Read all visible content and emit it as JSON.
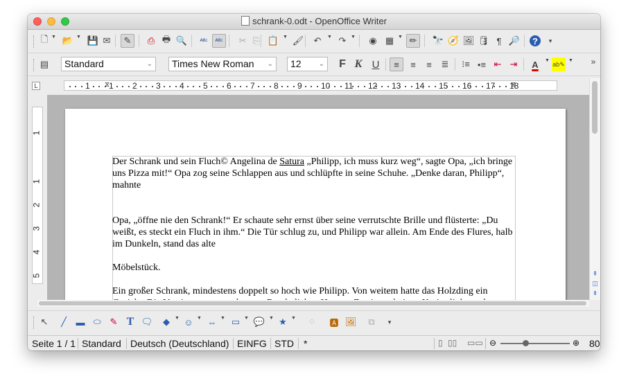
{
  "window": {
    "title": "schrank-0.odt - OpenOffice Writer"
  },
  "toolbar_standard": {
    "icons": [
      "new-icon",
      "open-icon",
      "save-icon",
      "email-icon",
      "edit-mode-icon",
      "export-pdf-icon",
      "print-icon",
      "page-preview-icon",
      "spellcheck-icon",
      "autospellcheck-icon",
      "cut-icon",
      "copy-icon",
      "paste-icon",
      "format-paintbrush-icon",
      "undo-icon",
      "redo-icon",
      "navigator-icon",
      "table-icon",
      "show-draw-functions-icon",
      "find-replace-icon",
      "compass-icon",
      "gallery-icon",
      "data-sources-icon",
      "formatting-marks-icon",
      "zoom-icon",
      "help-icon"
    ],
    "glyphs": [
      "🗋",
      "📂",
      "💾",
      "✉",
      "✎",
      "⎙",
      "🖶",
      "🔍",
      "ᴬᴮᶜ",
      "ᴬᴮᶜ",
      "✂",
      "⎘",
      "📋",
      "🖌",
      "↶",
      "↷",
      "◉",
      "▦",
      "✏",
      "🔭",
      "🧭",
      "🖼",
      "🛢",
      "¶",
      "🔎",
      "?"
    ]
  },
  "toolbar_formatting": {
    "style": "Standard",
    "font": "Times New Roman",
    "size": "12",
    "bold": "F",
    "italic": "K",
    "underline": "U"
  },
  "ruler": {
    "horizontal": [
      "1",
      "1",
      "2",
      "3",
      "4",
      "5",
      "6",
      "7",
      "8",
      "9",
      "10",
      "11",
      "12",
      "13",
      "14",
      "15",
      "16",
      "17",
      "18"
    ],
    "vertical": [
      "1",
      "1",
      "2",
      "3",
      "4",
      "5"
    ]
  },
  "document": {
    "p1": "Der Schrank und sein Fluch© Angelina de ",
    "p1_underlined": "Satura",
    "p1_rest": " „Philipp, ich muss kurz weg“, sagte Opa, „ich bringe uns Pizza mit!“ Opa zog seine Schlappen aus und schlüpfte in seine Schuhe. „Denke daran, Philipp“, mahnte",
    "p2": "Opa, „öffne nie den Schrank!“ Er schaute sehr ernst über seine verrutschte Brille und flüsterte: „Du weißt, es steckt ein Fluch in ihm.“ Die Tür schlug zu, und Philipp war allein. Am Ende des Flures, halb im Dunkeln, stand das alte",
    "p3": "Möbelstück.",
    "p4": "Ein großer Schrank, mindestens doppelt so hoch wie Philipp. Von weitem hatte das Holzding ein Gesicht. Die Verzierungen am obersten Rand glichen Haaren. Zwei geschnitzte Kreise links und"
  },
  "statusbar": {
    "page": "Seite 1 / 1",
    "style": "Standard",
    "language": "Deutsch (Deutschland)",
    "insert_mode": "EINFG",
    "selection_mode": "STD",
    "modified": "*",
    "zoom": "80"
  }
}
